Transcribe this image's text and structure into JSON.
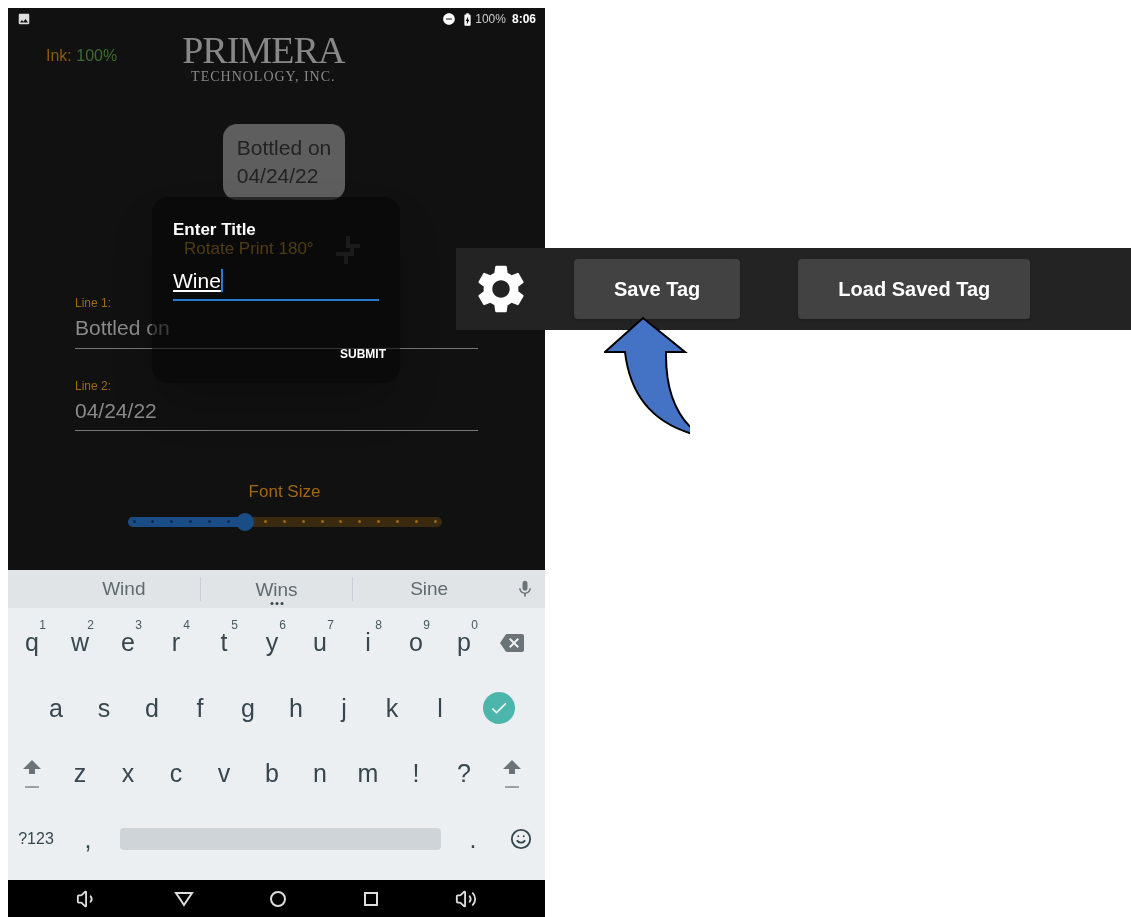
{
  "status_bar": {
    "battery": "100%",
    "time": "8:06"
  },
  "ink": {
    "label": "Ink:",
    "value": "100%"
  },
  "logo": {
    "name": "PRIMERA",
    "tagline": "TECHNOLOGY, INC."
  },
  "preview": {
    "lines": [
      "Bottled on",
      "04/24/22"
    ]
  },
  "rotate_option": {
    "label": "Rotate Print 180°"
  },
  "fields": [
    {
      "label": "Line 1:",
      "value": "Bottled on"
    },
    {
      "label": "Line 2:",
      "value": "04/24/22"
    }
  ],
  "font_size": {
    "label": "Font Size",
    "level": 0.375
  },
  "dialog": {
    "title": "Enter Title",
    "value": "Wine",
    "button": "SUBMIT"
  },
  "keyboard": {
    "suggestions": [
      {
        "text": "Wind",
        "has_more": false
      },
      {
        "text": "Wins",
        "has_more": true
      },
      {
        "text": "Sine",
        "has_more": false
      }
    ],
    "rows": [
      [
        {
          "kind": "char",
          "label": "q",
          "hint": "1"
        },
        {
          "kind": "char",
          "label": "w",
          "hint": "2"
        },
        {
          "kind": "char",
          "label": "e",
          "hint": "3"
        },
        {
          "kind": "char",
          "label": "r",
          "hint": "4"
        },
        {
          "kind": "char",
          "label": "t",
          "hint": "5"
        },
        {
          "kind": "char",
          "label": "y",
          "hint": "6"
        },
        {
          "kind": "char",
          "label": "u",
          "hint": "7"
        },
        {
          "kind": "char",
          "label": "i",
          "hint": "8"
        },
        {
          "kind": "char",
          "label": "o",
          "hint": "9"
        },
        {
          "kind": "char",
          "label": "p",
          "hint": "0"
        },
        {
          "kind": "backspace"
        }
      ],
      [
        {
          "kind": "char",
          "label": "a"
        },
        {
          "kind": "char",
          "label": "s"
        },
        {
          "kind": "char",
          "label": "d"
        },
        {
          "kind": "char",
          "label": "f"
        },
        {
          "kind": "char",
          "label": "g"
        },
        {
          "kind": "char",
          "label": "h"
        },
        {
          "kind": "char",
          "label": "j"
        },
        {
          "kind": "char",
          "label": "k"
        },
        {
          "kind": "char",
          "label": "l"
        },
        {
          "kind": "enter"
        }
      ],
      [
        {
          "kind": "shift"
        },
        {
          "kind": "char",
          "label": "z"
        },
        {
          "kind": "char",
          "label": "x"
        },
        {
          "kind": "char",
          "label": "c"
        },
        {
          "kind": "char",
          "label": "v"
        },
        {
          "kind": "char",
          "label": "b"
        },
        {
          "kind": "char",
          "label": "n"
        },
        {
          "kind": "char",
          "label": "m"
        },
        {
          "kind": "char",
          "label": "!"
        },
        {
          "kind": "char",
          "label": "?"
        },
        {
          "kind": "shift"
        }
      ],
      [
        {
          "kind": "symbols",
          "label": "?123"
        },
        {
          "kind": "char",
          "label": ","
        },
        {
          "kind": "space"
        },
        {
          "kind": "char",
          "label": "."
        },
        {
          "kind": "emoji"
        }
      ]
    ]
  },
  "toolbar": {
    "buttons": [
      "Save Tag",
      "Load Saved Tag"
    ]
  }
}
